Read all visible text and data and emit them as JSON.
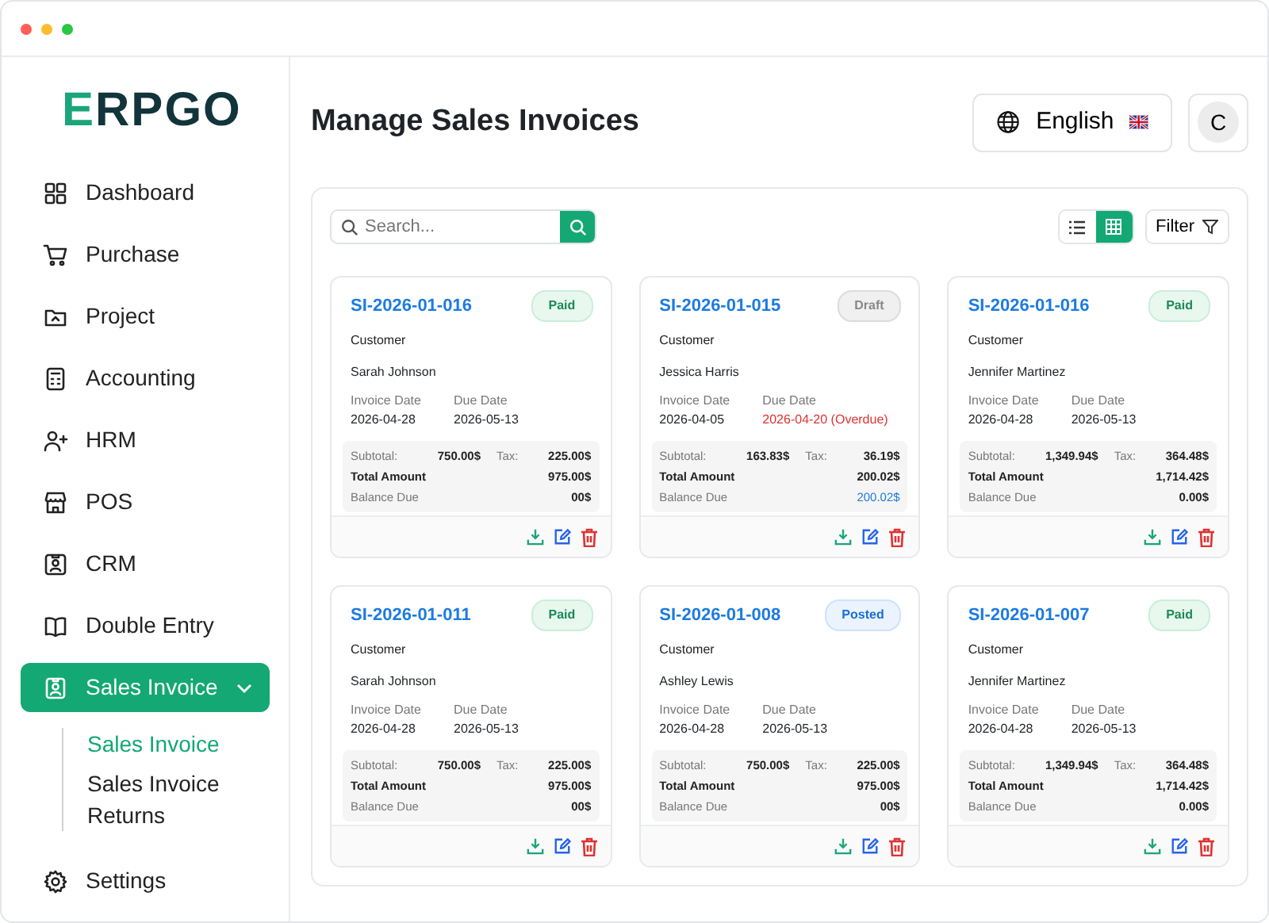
{
  "logo": {
    "accent": "E",
    "rest": "RPGO"
  },
  "sidebar": {
    "items": [
      {
        "label": "Dashboard",
        "selected": false
      },
      {
        "label": "Purchase",
        "selected": false
      },
      {
        "label": "Project",
        "selected": false
      },
      {
        "label": "Accounting",
        "selected": false
      },
      {
        "label": "HRM",
        "selected": false
      },
      {
        "label": "POS",
        "selected": false
      },
      {
        "label": "CRM",
        "selected": false
      },
      {
        "label": "Double Entry",
        "selected": false
      },
      {
        "label": "Sales Invoice",
        "selected": true,
        "expanded": true,
        "children": [
          {
            "label": "Sales Invoice",
            "selected": true
          },
          {
            "label": "Sales Invoice Returns",
            "selected": false
          }
        ]
      },
      {
        "label": "Settings",
        "selected": false
      }
    ]
  },
  "page_title": "Manage Sales Invoices",
  "language": {
    "label": "English"
  },
  "avatar": {
    "initial": "C"
  },
  "toolbar": {
    "search": {
      "placeholder": "Search..."
    },
    "views": [
      {
        "kind": "list",
        "selected": false
      },
      {
        "kind": "grid",
        "selected": true
      }
    ],
    "filter": "Filter"
  },
  "invoices": [
    {
      "number": "SI-2026-01-016",
      "status": "Paid",
      "kind": "paid",
      "customer_label": "Customer",
      "customer": "Sarah Johnson",
      "invoice_date_label": "Invoice Date",
      "invoice_date": "2026-04-28",
      "due_date_label": "Due Date",
      "due_date": "2026-05-13",
      "overdue": false,
      "subtotal_label": "Subtotal:",
      "subtotal": "750.00$",
      "tax_label": "Tax:",
      "tax": "225.00$",
      "total_label": "Total Amount",
      "total": "975.00$",
      "balance_label": "Balance Due",
      "balance": "00$",
      "outstanding": false
    },
    {
      "number": "SI-2026-01-015",
      "status": "Draft",
      "kind": "draft",
      "customer_label": "Customer",
      "customer": "Jessica Harris",
      "invoice_date_label": "Invoice Date",
      "invoice_date": "2026-04-05",
      "due_date_label": "Due Date",
      "due_date": "2026-04-20 (Overdue)",
      "overdue": true,
      "subtotal_label": "Subtotal:",
      "subtotal": "163.83$",
      "tax_label": "Tax:",
      "tax": "36.19$",
      "total_label": "Total Amount",
      "total": "200.02$",
      "balance_label": "Balance Due",
      "balance": "200.02$",
      "outstanding": true
    },
    {
      "number": "SI-2026-01-016",
      "status": "Paid",
      "kind": "paid",
      "customer_label": "Customer",
      "customer": "Jennifer Martinez",
      "invoice_date_label": "Invoice Date",
      "invoice_date": "2026-04-28",
      "due_date_label": "Due Date",
      "due_date": "2026-05-13",
      "overdue": false,
      "subtotal_label": "Subtotal:",
      "subtotal": "1,349.94$",
      "tax_label": "Tax:",
      "tax": "364.48$",
      "total_label": "Total Amount",
      "total": "1,714.42$",
      "balance_label": "Balance Due",
      "balance": "0.00$",
      "outstanding": false
    },
    {
      "number": "SI-2026-01-011",
      "status": "Paid",
      "kind": "paid",
      "customer_label": "Customer",
      "customer": "Sarah Johnson",
      "invoice_date_label": "Invoice Date",
      "invoice_date": "2026-04-28",
      "due_date_label": "Due Date",
      "due_date": "2026-05-13",
      "overdue": false,
      "subtotal_label": "Subtotal:",
      "subtotal": "750.00$",
      "tax_label": "Tax:",
      "tax": "225.00$",
      "total_label": "Total Amount",
      "total": "975.00$",
      "balance_label": "Balance Due",
      "balance": "00$",
      "outstanding": false
    },
    {
      "number": "SI-2026-01-008",
      "status": "Posted",
      "kind": "posted",
      "customer_label": "Customer",
      "customer": "Ashley Lewis",
      "invoice_date_label": "Invoice Date",
      "invoice_date": "2026-04-28",
      "due_date_label": "Due Date",
      "due_date": "2026-05-13",
      "overdue": false,
      "subtotal_label": "Subtotal:",
      "subtotal": "750.00$",
      "tax_label": "Tax:",
      "tax": "225.00$",
      "total_label": "Total Amount",
      "total": "975.00$",
      "balance_label": "Balance Due",
      "balance": "00$",
      "outstanding": false
    },
    {
      "number": "SI-2026-01-007",
      "status": "Paid",
      "kind": "paid",
      "customer_label": "Customer",
      "customer": "Jennifer Martinez",
      "invoice_date_label": "Invoice Date",
      "invoice_date": "2026-04-28",
      "due_date_label": "Due Date",
      "due_date": "2026-05-13",
      "overdue": false,
      "subtotal_label": "Subtotal:",
      "subtotal": "1,349.94$",
      "tax_label": "Tax:",
      "tax": "364.48$",
      "total_label": "Total Amount",
      "total": "1,714.42$",
      "balance_label": "Balance Due",
      "balance": "0.00$",
      "outstanding": false
    }
  ]
}
